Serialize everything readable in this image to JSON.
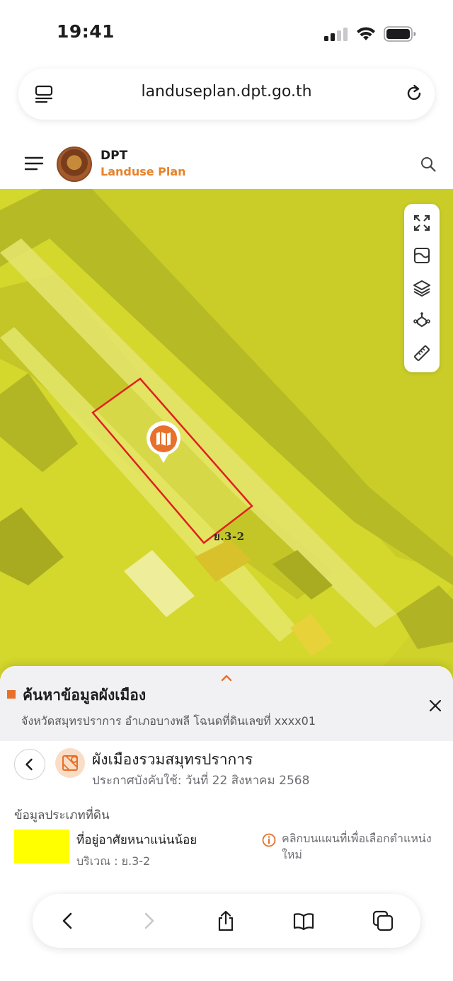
{
  "status": {
    "time": "19:41"
  },
  "browser": {
    "url": "landuseplan.dpt.go.th"
  },
  "site": {
    "brand": "DPT",
    "subtitle": "Landuse Plan"
  },
  "map": {
    "zone_label": "ย.3-2",
    "fill_color": "#e8e83a",
    "parcel_outline_color": "#e02020",
    "tools": [
      "expand-icon",
      "basemap-icon",
      "layers-icon",
      "satellite-icon",
      "ruler-icon"
    ]
  },
  "panel": {
    "title": "ค้นหาข้อมูลผังเมือง",
    "subtitle": "จังหวัดสมุทรปราการ อำเภอบางพลี โฉนดที่ดินเลขที่ xxxx01",
    "plan_name": "ผังเมืองรวมสมุทรปราการ",
    "plan_date": "ประกาศบังคับใช้: วันที่ 22 สิงหาคม 2568",
    "land_info_heading": "ข้อมูลประเภทที่ดิน",
    "zone_name": "ที่อยู่อาศัยหนาแน่นน้อย",
    "zone_area": "บริเวณ : ย.3-2",
    "zone_color": "#ffff00",
    "hint": "คลิกบนแผนที่เพื่อเลือกตำแหน่งใหม่",
    "accent": "#e8702a"
  }
}
